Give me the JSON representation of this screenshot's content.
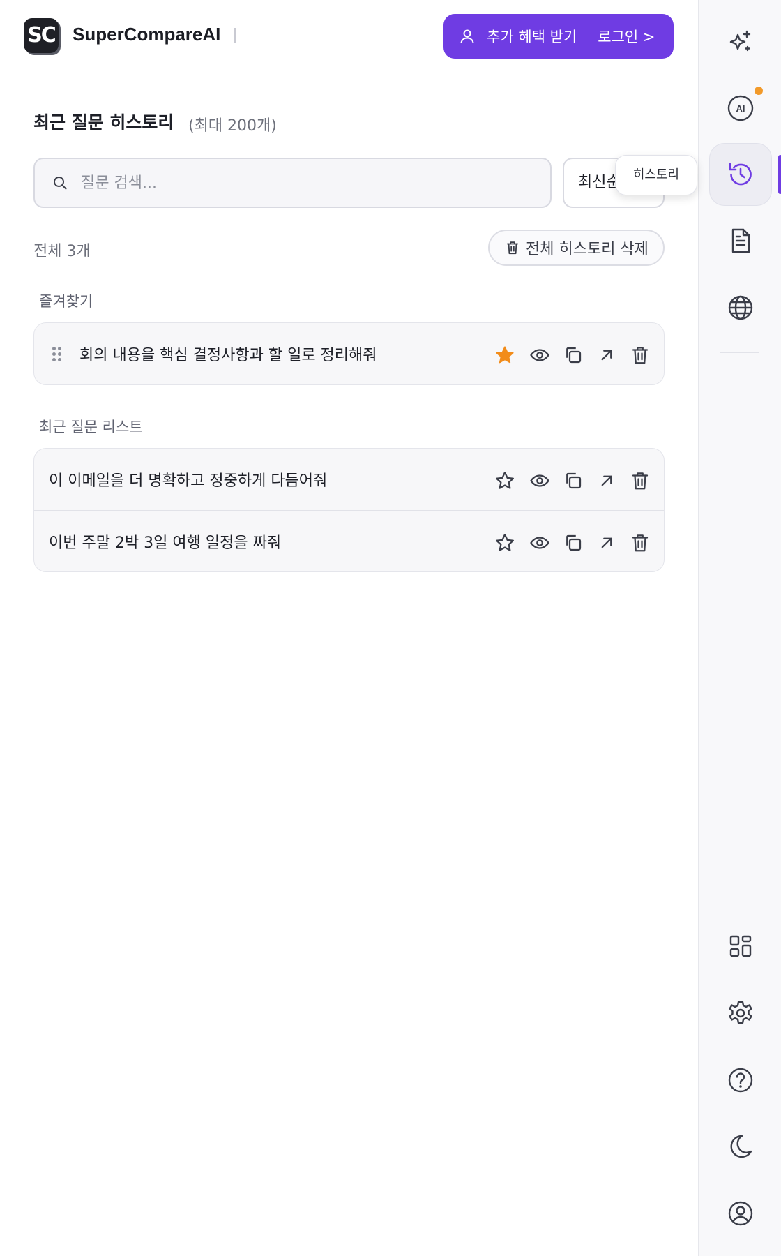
{
  "header": {
    "logo_text": "SC",
    "brand_name": "SuperCompareAI",
    "cta_benefit": "추가 혜택 받기",
    "cta_login": "로그인 >",
    "accent_color": "#6f3ce3"
  },
  "history": {
    "title": "최근 질문 히스토리",
    "subtitle": "(최대 200개)",
    "search_placeholder": "질문 검색...",
    "sort_label": "최신순",
    "tooltip": "히스토리",
    "count_label": "전체 3개",
    "clear_all_label": "전체 히스토리 삭제",
    "favorites_label": "즐겨찾기",
    "recent_label": "최근 질문 리스트",
    "favorites": [
      {
        "text": "회의 내용을 핵심 결정사항과 할 일로 정리해줘",
        "starred": true
      }
    ],
    "recent": [
      {
        "text": "이 이메일을 더 명확하고 정중하게 다듬어줘",
        "starred": false
      },
      {
        "text": "이번 주말 2박 3일 여행 일정을 짜줘",
        "starred": false
      }
    ],
    "star_color": "#f28c1a"
  },
  "sidebar": {
    "top_icons": [
      "sparkles-icon",
      "ai-icon",
      "history-icon",
      "document-icon",
      "globe-icon"
    ],
    "bottom_icons": [
      "apps-grid-icon",
      "settings-gear-icon",
      "help-icon",
      "dark-mode-moon-icon",
      "account-icon"
    ],
    "active": "history-icon",
    "notification_color": "#f29a2a"
  }
}
